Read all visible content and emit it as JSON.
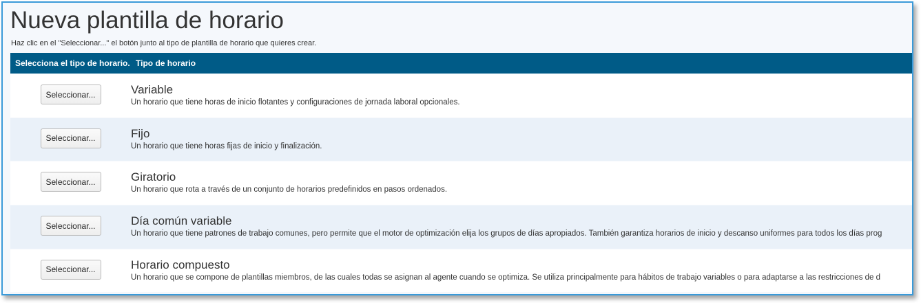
{
  "header": {
    "title": "Nueva plantilla de horario",
    "subtitle": "Haz clic en el \"Seleccionar...\" el botón junto al tipo de plantilla de horario que quieres crear."
  },
  "table": {
    "columns": [
      "Selecciona el tipo de horario.",
      "Tipo de horario"
    ],
    "rows": [
      {
        "button_label": "Seleccionar...",
        "name": "Variable",
        "description": "Un horario que tiene horas de inicio flotantes y configuraciones de jornada laboral opcionales."
      },
      {
        "button_label": "Seleccionar...",
        "name": "Fijo",
        "description": "Un horario que tiene horas fijas de inicio y finalización."
      },
      {
        "button_label": "Seleccionar...",
        "name": "Giratorio",
        "description": "Un horario que rota a través de un conjunto de horarios predefinidos en pasos ordenados."
      },
      {
        "button_label": "Seleccionar...",
        "name": "Día común variable",
        "description": "Un horario que tiene patrones de trabajo comunes, pero permite que el motor de optimización elija los grupos de días apropiados. También garantiza horarios de inicio y descanso uniformes para todos los días prog"
      },
      {
        "button_label": "Seleccionar...",
        "name": "Horario compuesto",
        "description": "Un horario que se compone de plantillas miembros, de las cuales todas se asignan al agente cuando se optimiza. Se utiliza principalmente para hábitos de trabajo variables o para adaptarse a las restricciones de d"
      }
    ]
  },
  "colors": {
    "header_bar": "#005b87",
    "frame_border": "#3a9ad9",
    "row_alt": "#eaf1f9"
  }
}
